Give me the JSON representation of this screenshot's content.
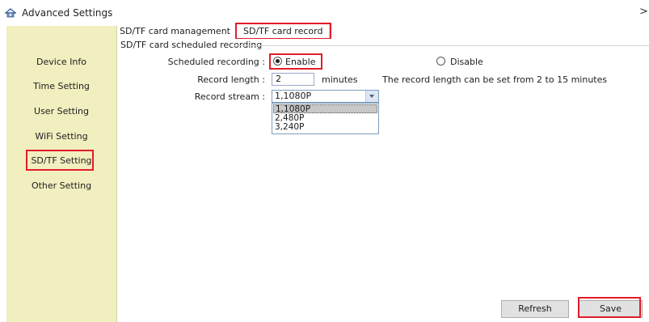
{
  "window": {
    "title": "Advanced Settings",
    "close_glyph": ">"
  },
  "sidebar": {
    "items": [
      {
        "label": "Device Info"
      },
      {
        "label": "Time Setting"
      },
      {
        "label": "User Setting"
      },
      {
        "label": "WiFi Setting"
      },
      {
        "label": "SD/TF Setting",
        "selected": true
      },
      {
        "label": "Other Setting"
      }
    ]
  },
  "tabs": [
    {
      "label": "SD/TF card management"
    },
    {
      "label": "SD/TF card record",
      "active": true
    }
  ],
  "group": {
    "title": "SD/TF card scheduled recording",
    "scheduled_label": "Scheduled recording :",
    "enable_label": "Enable",
    "disable_label": "Disable",
    "scheduled_value": "Enable",
    "length_label": "Record length :",
    "length_value": "2",
    "length_unit": "minutes",
    "length_hint": "The record length can be set from 2 to 15 minutes",
    "stream_label": "Record stream :",
    "stream_value": "1,1080P",
    "stream_options": [
      "1,1080P",
      "2,480P",
      "3,240P"
    ]
  },
  "buttons": {
    "refresh": "Refresh",
    "save": "Save"
  },
  "colors": {
    "sidebar_bg": "#f1eebf",
    "highlight": "#e21c2a",
    "button_bg": "#e1e1e1"
  },
  "icons": {
    "app": "camera-home-icon",
    "close": "close-icon"
  }
}
